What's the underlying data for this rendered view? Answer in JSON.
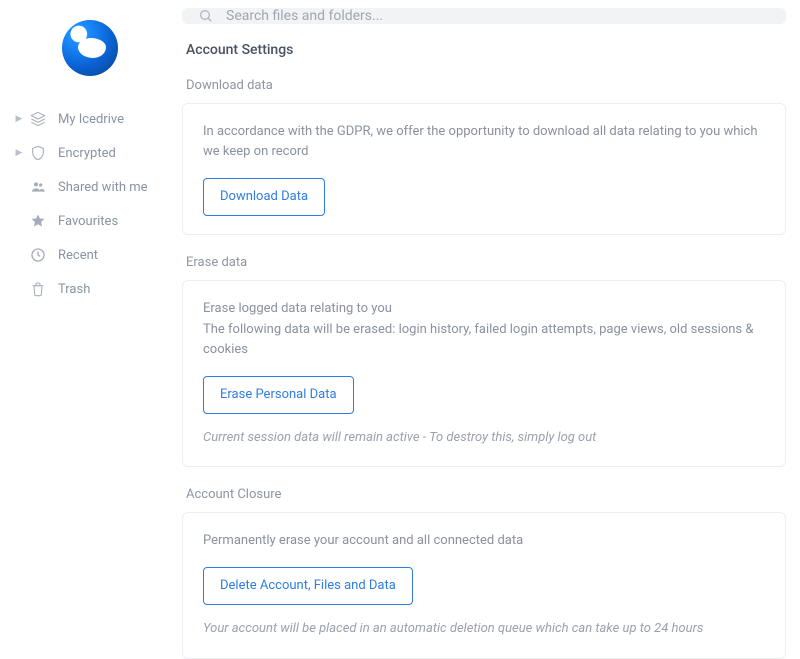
{
  "search": {
    "placeholder": "Search files and folders..."
  },
  "sidebar": {
    "items": [
      {
        "label": "My Icedrive",
        "icon": "stack-icon",
        "hasChevron": true
      },
      {
        "label": "Encrypted",
        "icon": "shield-icon",
        "hasChevron": true
      },
      {
        "label": "Shared with me",
        "icon": "people-icon",
        "hasChevron": false
      },
      {
        "label": "Favourites",
        "icon": "star-icon",
        "hasChevron": false
      },
      {
        "label": "Recent",
        "icon": "clock-icon",
        "hasChevron": false
      },
      {
        "label": "Trash",
        "icon": "trash-icon",
        "hasChevron": false
      }
    ]
  },
  "page": {
    "title": "Account Settings"
  },
  "sections": {
    "download": {
      "heading": "Download data",
      "desc": "In accordance with the GDPR, we offer the opportunity to download all data relating to you which we keep on record",
      "button": "Download Data"
    },
    "erase": {
      "heading": "Erase data",
      "desc1": "Erase logged data relating to you",
      "desc2": "The following data will be erased: login history, failed login attempts, page views, old sessions & cookies",
      "button": "Erase Personal Data",
      "note": "Current session data will remain active - To destroy this, simply log out"
    },
    "closure": {
      "heading": "Account Closure",
      "desc": "Permanently erase your account and all connected data",
      "button": "Delete Account, Files and Data",
      "note": "Your account will be placed in an automatic deletion queue which can take up to 24 hours"
    }
  }
}
